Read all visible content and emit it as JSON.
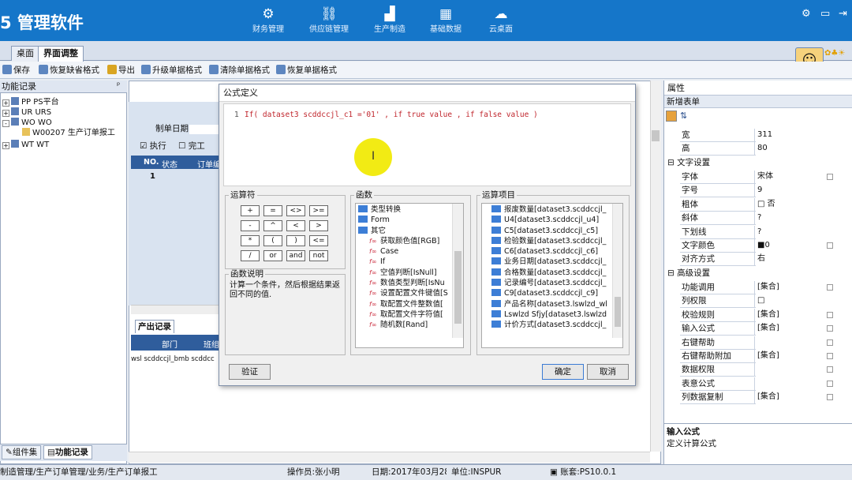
{
  "header": {
    "app_title": "5 管理软件",
    "nav": [
      {
        "icon": "⚙",
        "label": "财务管理"
      },
      {
        "icon": "⛓",
        "label": "供应链管理"
      },
      {
        "icon": "▟",
        "label": "生产制造"
      },
      {
        "icon": "▦",
        "label": "基础数据"
      },
      {
        "icon": "☁",
        "label": "云桌面"
      }
    ]
  },
  "tabs": [
    "桌面",
    "界面调整"
  ],
  "avatar": {
    "lang": "英"
  },
  "toolbar": [
    "保存",
    "恢复缺省格式",
    "导出",
    "升级单据格式",
    "清除单据格式",
    "恢复单据格式"
  ],
  "left_panel": {
    "title": "功能记录",
    "pin": "ᵖ",
    "tree": [
      {
        "box": "+",
        "label": "PP  PS平台"
      },
      {
        "box": "+",
        "label": "UR  URS"
      },
      {
        "box": "-",
        "label": "WO  WO"
      },
      {
        "box": "",
        "label": "W00207  生产订单报工"
      },
      {
        "box": "+",
        "label": "WT  WT"
      }
    ],
    "bottom_tabs": [
      "组件集",
      "功能记录"
    ]
  },
  "center": {
    "date_label": "制单日期",
    "chk_exec": "执行",
    "chk_done": "完工",
    "grid_headers": [
      "NO.",
      "状态",
      "订单编"
    ],
    "row1": "1",
    "sub_tab": "产出记录",
    "sub_headers": [
      "部门",
      "班组"
    ],
    "sub_row": "wsl  scddccjl_bmb scddcc"
  },
  "dialog": {
    "title": "公式定义",
    "line_no": "1",
    "formula": "If( dataset3 scddccjl_c1 ='01'  ,  if true value  ,  if false value  )",
    "operators_label": "运算符",
    "operators": [
      "+",
      "=",
      "<>",
      ">=",
      "-",
      "^",
      "<",
      ">",
      "*",
      "(",
      ")",
      "<=",
      "/",
      "or",
      "and",
      "not"
    ],
    "func_label": "函数",
    "functions": [
      {
        "t": "n",
        "label": "类型转换"
      },
      {
        "t": "n",
        "label": "Form"
      },
      {
        "t": "n",
        "label": "其它"
      },
      {
        "t": "f",
        "label": "获取颜色值[RGB]"
      },
      {
        "t": "f",
        "label": "Case"
      },
      {
        "t": "f",
        "label": "If"
      },
      {
        "t": "f",
        "label": "空值判断[IsNull]"
      },
      {
        "t": "f",
        "label": "数值类型判断[IsNu"
      },
      {
        "t": "f",
        "label": "设置配置文件键值[S"
      },
      {
        "t": "f",
        "label": "取配置文件整数值["
      },
      {
        "t": "f",
        "label": "取配置文件字符值["
      },
      {
        "t": "f",
        "label": "随机数[Rand]"
      }
    ],
    "items_label": "运算项目",
    "items": [
      "报废数量[dataset3.scddccjl_",
      "U4[dataset3.scddccjl_u4]",
      "C5[dataset3.scddccjl_c5]",
      "检验数量[dataset3.scddccjl_",
      "C6[dataset3.scddccjl_c6]",
      "业务日期[dataset3.scddccjl_",
      "合格数量[dataset3.scddccjl_",
      "记录编号[dataset3.scddccjl_",
      "C9[dataset3.scddccjl_c9]",
      "产品名称[dataset3.lswlzd_wl",
      "Lswlzd Sfjy[dataset3.lswlzd",
      "计价方式[dataset3.scddccjl_"
    ],
    "desc_label": "函数说明",
    "desc": "计算一个条件，然后根据结果返回不同的值.",
    "verify": "验证",
    "ok": "确定",
    "cancel": "取消"
  },
  "right_panel": {
    "title": "属性",
    "subtitle": "新增表单",
    "rows_top": [
      {
        "k": "宽",
        "v": "311"
      },
      {
        "k": "高",
        "v": "80"
      }
    ],
    "sec1": "文字设置",
    "rows_text": [
      {
        "k": "字体",
        "v": "宋体",
        "dd": true
      },
      {
        "k": "字号",
        "v": "9"
      },
      {
        "k": "粗体",
        "v": "□ 否"
      },
      {
        "k": "斜体",
        "v": "?"
      },
      {
        "k": "下划线",
        "v": "?"
      },
      {
        "k": "文字颜色",
        "v": "■0",
        "dd": true
      },
      {
        "k": "对齐方式",
        "v": "右"
      }
    ],
    "sec2": "高级设置",
    "rows_adv": [
      {
        "k": "功能调用",
        "v": "[集合]",
        "dd": true
      },
      {
        "k": "列权限",
        "v": "□"
      },
      {
        "k": "校验规则",
        "v": "[集合]",
        "dd": true
      },
      {
        "k": "输入公式",
        "v": "[集合]",
        "dd": true
      },
      {
        "k": "右键帮助",
        "v": "",
        "dd": true
      },
      {
        "k": "右键帮助附加",
        "v": "[集合]",
        "dd": true
      },
      {
        "k": "数据权限",
        "v": "",
        "dd": true
      },
      {
        "k": "表意公式",
        "v": "",
        "dd": true
      },
      {
        "k": "列数据复制",
        "v": "[集合]",
        "dd": true
      }
    ],
    "help_title": "输入公式",
    "help_text": "定义计算公式"
  },
  "status": {
    "path": "制造管理/生产订单管理/业务/生产订单报工",
    "operator": "操作员:张小明",
    "date": "日期:2017年03月28",
    "unit": "单位:INSPUR",
    "account": "账套:PS10.0.1"
  }
}
